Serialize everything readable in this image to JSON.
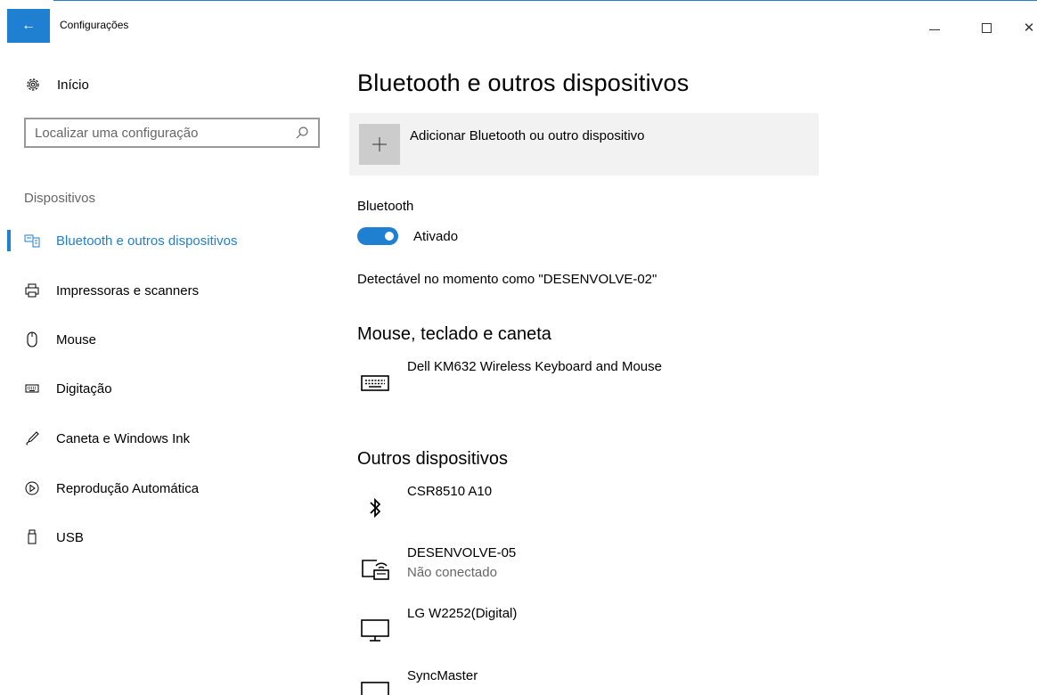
{
  "window": {
    "title": "Configurações",
    "back_icon": "arrow-left-icon",
    "back_symbol": "←",
    "close_symbol": "✕"
  },
  "sidebar": {
    "home_label": "Início",
    "search_placeholder": "Localizar uma configuração",
    "section_label": "Dispositivos",
    "items": [
      {
        "label": "Bluetooth e outros dispositivos",
        "icon": "bluetooth-devices-icon",
        "active": true
      },
      {
        "label": "Impressoras e scanners",
        "icon": "printer-icon",
        "active": false
      },
      {
        "label": "Mouse",
        "icon": "mouse-icon",
        "active": false
      },
      {
        "label": "Digitação",
        "icon": "keyboard-icon",
        "active": false
      },
      {
        "label": "Caneta e Windows Ink",
        "icon": "pen-icon",
        "active": false
      },
      {
        "label": "Reprodução Automática",
        "icon": "autoplay-icon",
        "active": false
      },
      {
        "label": "USB",
        "icon": "usb-icon",
        "active": false
      }
    ]
  },
  "main": {
    "title": "Bluetooth e outros dispositivos",
    "add_device_label": "Adicionar Bluetooth ou outro dispositivo",
    "bluetooth_heading": "Bluetooth",
    "bluetooth_state": "Ativado",
    "discoverable_text": "Detectável no momento como \"DESENVOLVE-02\"",
    "groups": [
      {
        "title": "Mouse, teclado e caneta",
        "devices": [
          {
            "name": "Dell KM632 Wireless Keyboard and Mouse",
            "status": "",
            "icon": "keyboard-icon"
          }
        ]
      },
      {
        "title": "Outros dispositivos",
        "devices": [
          {
            "name": "CSR8510 A10",
            "status": "",
            "icon": "bluetooth-icon"
          },
          {
            "name": "DESENVOLVE-05",
            "status": "Não conectado",
            "icon": "network-pc-icon"
          },
          {
            "name": "LG W2252(Digital)",
            "status": "",
            "icon": "monitor-icon"
          },
          {
            "name": "SyncMaster",
            "status": "",
            "icon": "monitor-icon"
          }
        ]
      }
    ]
  },
  "colors": {
    "accent": "#1f7fd1",
    "tile_bg": "#f2f2f2",
    "plus_bg": "#cccccc",
    "secondary_text": "#666666"
  }
}
